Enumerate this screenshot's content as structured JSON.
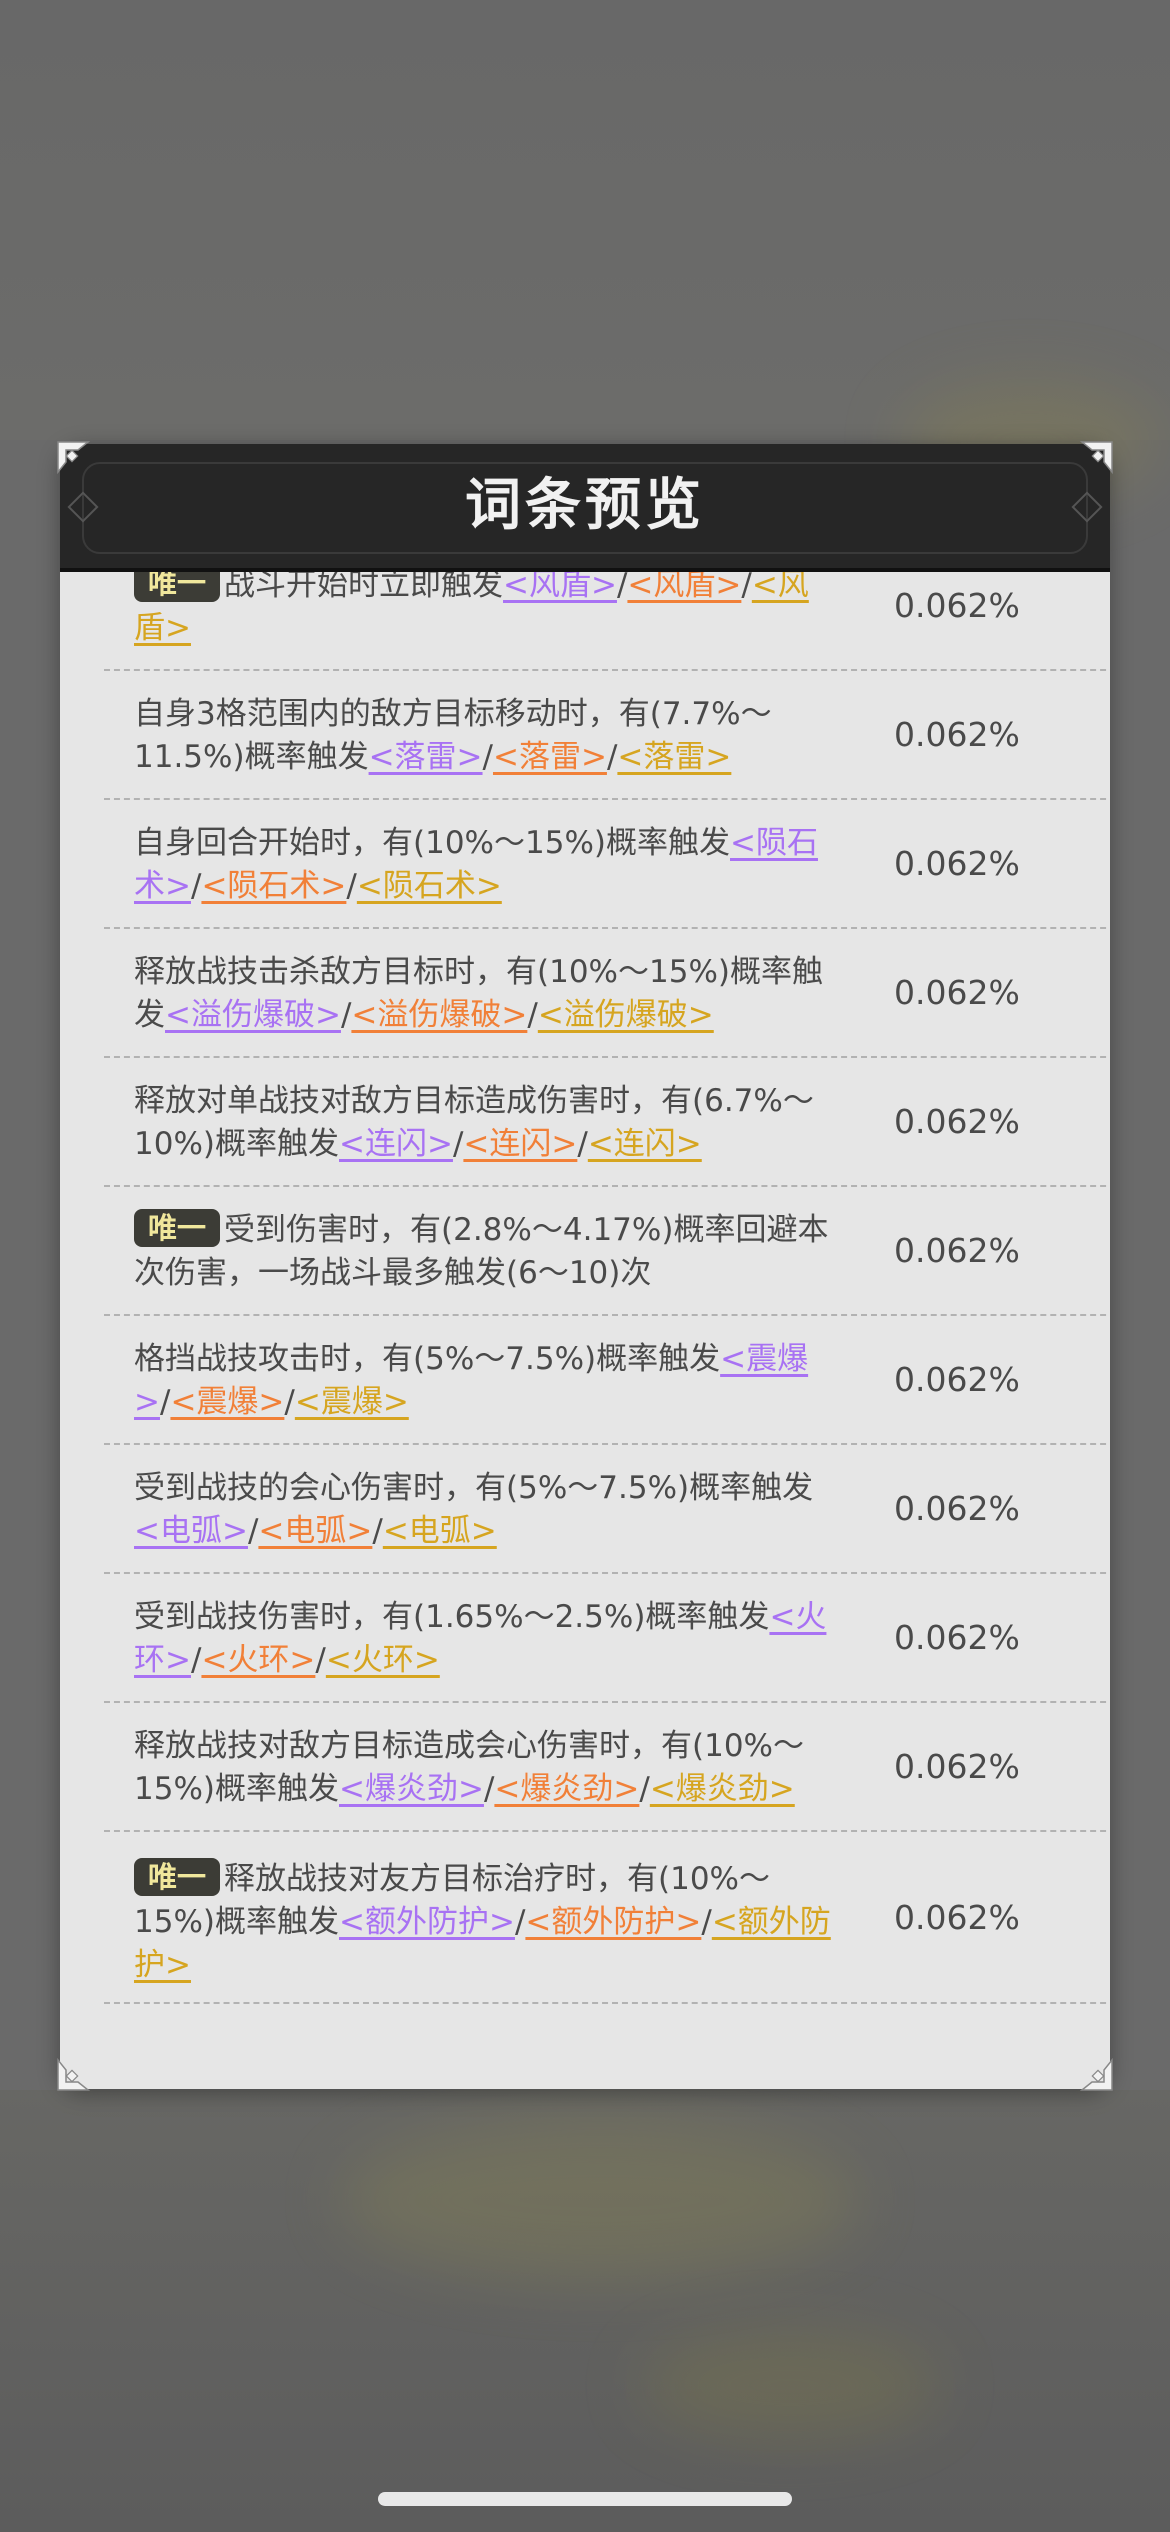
{
  "dialog": {
    "title": "词条预览"
  },
  "rows": [
    {
      "tag": "唯一",
      "text": "战斗开始时立即触发",
      "links": [
        "<风盾>",
        "<风盾>",
        "<风盾>"
      ],
      "prob": "0.062%"
    },
    {
      "tag": "",
      "text": "自身3格范围内的敌方目标移动时，有(7.7%～11.5%)概率触发",
      "links": [
        "<落雷>",
        "<落雷>",
        "<落雷>"
      ],
      "prob": "0.062%"
    },
    {
      "tag": "",
      "text": "自身回合开始时，有(10%～15%)概率触发",
      "links": [
        "<陨石术>",
        "<陨石术>",
        "<陨石术>"
      ],
      "prob": "0.062%"
    },
    {
      "tag": "",
      "text": "释放战技击杀敌方目标时，有(10%～15%)概率触发",
      "links": [
        "<溢伤爆破>",
        "<溢伤爆破>",
        "<溢伤爆破>"
      ],
      "prob": "0.062%"
    },
    {
      "tag": "",
      "text": "释放对单战技对敌方目标造成伤害时，有(6.7%～10%)概率触发",
      "links": [
        "<连闪>",
        "<连闪>",
        "<连闪>"
      ],
      "prob": "0.062%"
    },
    {
      "tag": "唯一",
      "text": "受到伤害时，有(2.8%～4.17%)概率回避本次伤害，一场战斗最多触发(6～10)次",
      "links": [],
      "prob": "0.062%"
    },
    {
      "tag": "",
      "text": "格挡战技攻击时，有(5%～7.5%)概率触发",
      "links": [
        "<震爆>",
        "<震爆>",
        "<震爆>"
      ],
      "prob": "0.062%"
    },
    {
      "tag": "",
      "text": "受到战技的会心伤害时，有(5%～7.5%)概率触发",
      "links": [
        "<电弧>",
        "<电弧>",
        "<电弧>"
      ],
      "prob": "0.062%"
    },
    {
      "tag": "",
      "text": "受到战技伤害时，有(1.65%～2.5%)概率触发",
      "links": [
        "<火环>",
        "<火环>",
        "<火环>"
      ],
      "prob": "0.062%"
    },
    {
      "tag": "",
      "text": "释放战技对敌方目标造成会心伤害时，有(10%～15%)概率触发",
      "links": [
        "<爆炎劲>",
        "<爆炎劲>",
        "<爆炎劲>"
      ],
      "prob": "0.062%"
    },
    {
      "tag": "唯一",
      "text": "释放战技对友方目标治疗时，有(10%～15%)概率触发",
      "links": [
        "<额外防护>",
        "<额外防护>",
        "<额外防护>"
      ],
      "prob": "0.062%"
    }
  ],
  "separator": "/",
  "colors": {
    "panel_bg": "#e6e6e6",
    "header_bg": "#262626",
    "tag_bg": "#3c3c36",
    "tag_text": "#f0e79c",
    "link_purple": "#a872f3",
    "link_orange": "#f18038",
    "link_gold": "#d6a520"
  }
}
